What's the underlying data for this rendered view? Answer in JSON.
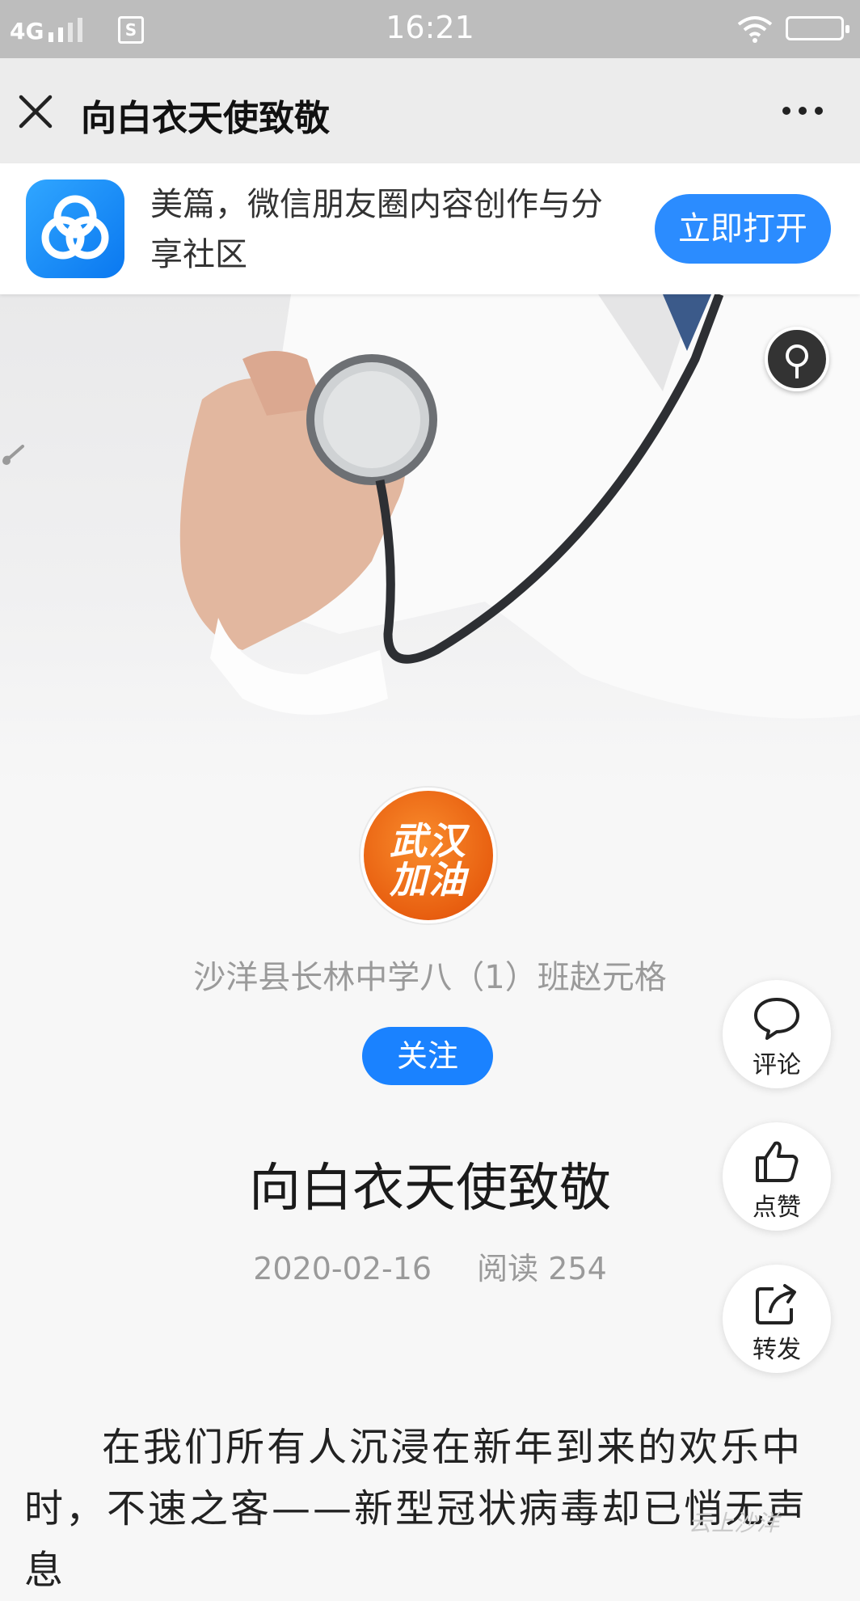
{
  "status_bar": {
    "network": "4G",
    "sim_badge": "S",
    "time": "16:21"
  },
  "nav": {
    "title": "向白衣天使致敬"
  },
  "banner": {
    "description": "美篇，微信朋友圈内容创作与分享社区",
    "open_label": "立即打开"
  },
  "author": {
    "avatar_text_line1": "武汉",
    "avatar_text_line2": "加油",
    "name": "沙洋县长林中学八（1）班赵元格",
    "follow_label": "关注"
  },
  "article": {
    "title": "向白衣天使致敬",
    "date": "2020-02-16",
    "read_label": "阅读 254",
    "body": "在我们所有人沉浸在新年到来的欢乐中时，不速之客——新型冠状病毒却已悄无声息"
  },
  "actions": {
    "comment": "评论",
    "like": "点赞",
    "share": "转发"
  },
  "watermark": "云上沙洋",
  "colors": {
    "accent": "#1a82ff",
    "banner_button": "#2b8cff",
    "status_bar": "#bdbdbd"
  }
}
